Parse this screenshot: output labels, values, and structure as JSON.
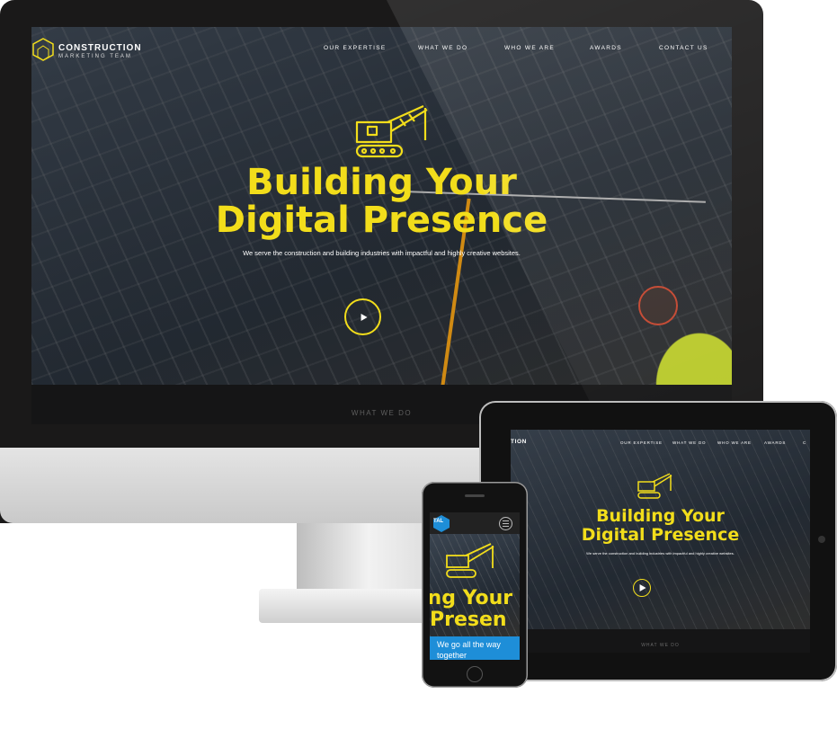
{
  "brand": {
    "line1": "CONSTRUCTION",
    "line2": "MARKETING TEAM",
    "short": "TAL"
  },
  "nav": [
    "OUR EXPERTISE",
    "WHAT WE DO",
    "WHO WE ARE",
    "AWARDS",
    "CONTACT US"
  ],
  "hero": {
    "title_line1": "Building Your",
    "title_line2": "Digital Presence",
    "subtitle": "We serve the construction and building industries with impactful and highly creative websites."
  },
  "section_label": "WHAT WE DO",
  "tablet": {
    "brand_fragment": "TION",
    "nav": [
      "OUR EXPERTISE",
      "WHAT WE DO",
      "WHO WE ARE",
      "AWARDS",
      "C"
    ]
  },
  "phone": {
    "title_line1": "ing Your",
    "title_line2": "Presen",
    "banner": "We go all the way together"
  },
  "colors": {
    "accent": "#f2dd1b",
    "frame": "#1a1919",
    "phone_banner": "#1e8ed8"
  },
  "icons": [
    "crane-icon",
    "play-icon",
    "menu-icon",
    "logo-hex-icon"
  ]
}
